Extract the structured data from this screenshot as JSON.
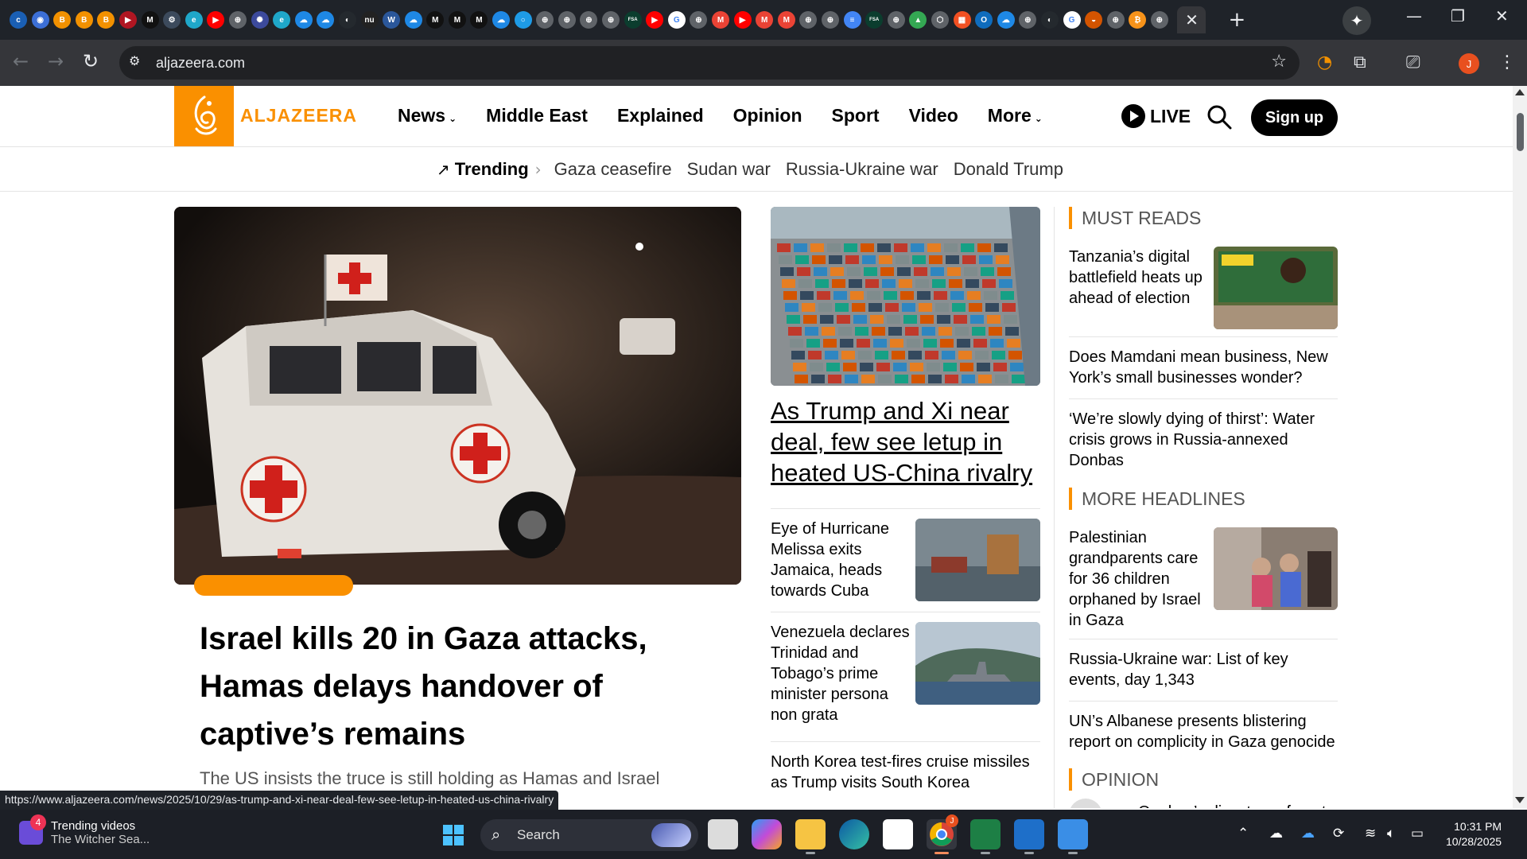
{
  "browser": {
    "tab_favicons": [
      {
        "name": "ccec",
        "color": "#1a5fb4",
        "glyph": "c"
      },
      {
        "name": "circle-blue",
        "color": "#3c6fd6",
        "glyph": "◉"
      },
      {
        "name": "orange-b",
        "color": "#f29100",
        "glyph": "B"
      },
      {
        "name": "orange-b2",
        "color": "#f29100",
        "glyph": "B"
      },
      {
        "name": "orange-b3",
        "color": "#f29100",
        "glyph": "B"
      },
      {
        "name": "youtube-dark",
        "color": "#b01622",
        "glyph": "▶"
      },
      {
        "name": "medium",
        "color": "#111111",
        "glyph": "M"
      },
      {
        "name": "chatgpt",
        "color": "#3c4a5c",
        "glyph": "⚙"
      },
      {
        "name": "edge",
        "color": "#1fa7c9",
        "glyph": "e"
      },
      {
        "name": "youtube",
        "color": "#ff0000",
        "glyph": "▶"
      },
      {
        "name": "globe",
        "color": "#5f6368",
        "glyph": "⊕"
      },
      {
        "name": "ai",
        "color": "#3c4a9c",
        "glyph": "✺"
      },
      {
        "name": "edge2",
        "color": "#1fa7c9",
        "glyph": "e"
      },
      {
        "name": "onedrive",
        "color": "#1e88e5",
        "glyph": "☁"
      },
      {
        "name": "onedrive2",
        "color": "#1e88e5",
        "glyph": "☁"
      },
      {
        "name": "github",
        "color": "#24292e",
        "glyph": "◐"
      },
      {
        "name": "nu",
        "color": "#222222",
        "glyph": "nu"
      },
      {
        "name": "word",
        "color": "#2b579a",
        "glyph": "W"
      },
      {
        "name": "onedrive3",
        "color": "#1e88e5",
        "glyph": "☁"
      },
      {
        "name": "medium2",
        "color": "#111111",
        "glyph": "M"
      },
      {
        "name": "medium3",
        "color": "#111111",
        "glyph": "M"
      },
      {
        "name": "medium4",
        "color": "#111111",
        "glyph": "M"
      },
      {
        "name": "onedrive4",
        "color": "#1e88e5",
        "glyph": "☁"
      },
      {
        "name": "ring",
        "color": "#1e9be6",
        "glyph": "○"
      },
      {
        "name": "globe2",
        "color": "#5f6368",
        "glyph": "⊕"
      },
      {
        "name": "globe3",
        "color": "#5f6368",
        "glyph": "⊕"
      },
      {
        "name": "globe4",
        "color": "#5f6368",
        "glyph": "⊕"
      },
      {
        "name": "globe5",
        "color": "#5f6368",
        "glyph": "⊕"
      },
      {
        "name": "fsa",
        "color": "#0b3d2e",
        "glyph": "FSA"
      },
      {
        "name": "youtube2",
        "color": "#ff0000",
        "glyph": "▶"
      },
      {
        "name": "google",
        "color": "#ffffff",
        "glyph": "G"
      },
      {
        "name": "globe6",
        "color": "#5f6368",
        "glyph": "⊕"
      },
      {
        "name": "gmail",
        "color": "#ea4335",
        "glyph": "M"
      },
      {
        "name": "youtube3",
        "color": "#ff0000",
        "glyph": "▶"
      },
      {
        "name": "gmail2",
        "color": "#ea4335",
        "glyph": "M"
      },
      {
        "name": "gmail3",
        "color": "#ea4335",
        "glyph": "M"
      },
      {
        "name": "globe7",
        "color": "#5f6368",
        "glyph": "⊕"
      },
      {
        "name": "globe8",
        "color": "#5f6368",
        "glyph": "⊕"
      },
      {
        "name": "docs",
        "color": "#4285f4",
        "glyph": "≡"
      },
      {
        "name": "fsa2",
        "color": "#0b3d2e",
        "glyph": "FSA"
      },
      {
        "name": "globe9",
        "color": "#5f6368",
        "glyph": "⊕"
      },
      {
        "name": "drive",
        "color": "#34a853",
        "glyph": "▲"
      },
      {
        "name": "hex",
        "color": "#5f6368",
        "glyph": "⬡"
      },
      {
        "name": "microsoft",
        "color": "#f25022",
        "glyph": "▦"
      },
      {
        "name": "outlook",
        "color": "#0f6cbd",
        "glyph": "O"
      },
      {
        "name": "onedrive5",
        "color": "#1e88e5",
        "glyph": "☁"
      },
      {
        "name": "globe10",
        "color": "#5f6368",
        "glyph": "⊕"
      },
      {
        "name": "github2",
        "color": "#24292e",
        "glyph": "◐"
      },
      {
        "name": "google2",
        "color": "#ffffff",
        "glyph": "G"
      },
      {
        "name": "sun",
        "color": "#d35400",
        "glyph": "◒"
      },
      {
        "name": "globe11",
        "color": "#5f6368",
        "glyph": "⊕"
      },
      {
        "name": "bitcoin",
        "color": "#f7931a",
        "glyph": "₿"
      },
      {
        "name": "globe12",
        "color": "#5f6368",
        "glyph": "⊕"
      }
    ],
    "active_tab_close": "✕",
    "new_tab": "+",
    "url": "aljazeera.com",
    "profile_initial": "J",
    "status_url": "https://www.aljazeera.com/news/2025/10/29/as-trump-and-xi-near-deal-few-see-letup-in-heated-us-china-rivalry"
  },
  "site": {
    "logo_text": "ALJAZEERA",
    "nav": [
      {
        "label": "News",
        "dropdown": true
      },
      {
        "label": "Middle East",
        "dropdown": false
      },
      {
        "label": "Explained",
        "dropdown": false
      },
      {
        "label": "Opinion",
        "dropdown": false
      },
      {
        "label": "Sport",
        "dropdown": false
      },
      {
        "label": "Video",
        "dropdown": false
      },
      {
        "label": "More",
        "dropdown": true
      }
    ],
    "live_label": "LIVE",
    "signup_label": "Sign up",
    "brand_color": "#fa9000"
  },
  "trending": {
    "title": "Trending",
    "links": [
      "Gaza ceasefire",
      "Sudan war",
      "Russia-Ukraine war",
      "Donald Trump"
    ]
  },
  "lead": {
    "title": "Israel kills 20 in Gaza attacks, Hamas delays handover of captive’s remains",
    "subtitle": "The US insists the truce is still holding as Hamas and Israel"
  },
  "middle": {
    "feature_title": "As Trump and Xi near deal, few see letup in heated US-China rivalry",
    "items": [
      {
        "title": "Eye of Hurricane Melissa exits Jamaica, heads towards Cuba"
      },
      {
        "title": "Venezuela declares Trinidad and Tobago’s prime minister persona non grata"
      },
      {
        "title": "North Korea test-fires cruise missiles as Trump visits South Korea"
      }
    ]
  },
  "right": {
    "must_reads": {
      "heading": "MUST READS",
      "items": [
        {
          "title": "Tanzania’s digital battlefield heats up ahead of election"
        },
        {
          "title": "Does Mamdani mean business, New York’s small businesses wonder?"
        },
        {
          "title": "‘We’re slowly dying of thirst’: Water crisis grows in Russia-annexed Donbas"
        }
      ]
    },
    "more_headlines": {
      "heading": "MORE HEADLINES",
      "items": [
        {
          "title": "Palestinian grandparents care for 36 children orphaned by Israel in Gaza"
        },
        {
          "title": "Russia-Ukraine war: List of key events, day 1,343"
        },
        {
          "title": "UN’s Albanese presents blistering report on complicity in Gaza genocide"
        }
      ]
    },
    "opinion": {
      "heading": "OPINION",
      "items": [
        {
          "title": "Quebec’s disastrous forest"
        }
      ]
    }
  },
  "taskbar": {
    "widget_badge": "4",
    "widget_title": "Trending videos",
    "widget_subtitle": "The Witcher Sea...",
    "search_label": "Search",
    "time": "10:31 PM",
    "date": "10/28/2025",
    "chrome_badge": "J"
  }
}
